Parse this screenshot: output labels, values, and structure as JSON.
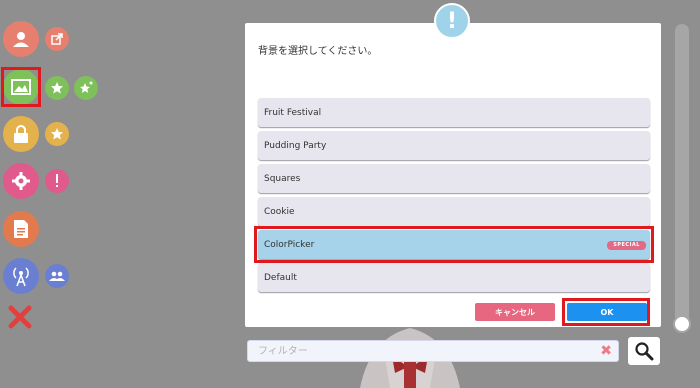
{
  "sidebar": {
    "buttons": [
      {
        "icon": "user-icon"
      },
      {
        "icon": "share-icon"
      },
      {
        "icon": "background-image-icon"
      },
      {
        "icon": "star-icon"
      },
      {
        "icon": "star-sparkle-icon"
      },
      {
        "icon": "lock-icon"
      },
      {
        "icon": "star-icon"
      },
      {
        "icon": "gear-icon"
      },
      {
        "icon": "exclamation-icon"
      },
      {
        "icon": "document-icon"
      },
      {
        "icon": "broadcast-tower-icon"
      },
      {
        "icon": "group-icon"
      },
      {
        "icon": "close-icon"
      }
    ]
  },
  "dialog": {
    "badge": "!",
    "message": "背景を選択してください。",
    "options": [
      {
        "label": "Fruit Festival",
        "tag": ""
      },
      {
        "label": "Pudding Party",
        "tag": ""
      },
      {
        "label": "Squares",
        "tag": ""
      },
      {
        "label": "Cookie",
        "tag": ""
      },
      {
        "label": "ColorPicker",
        "tag": "SPECIAL"
      },
      {
        "label": "Default",
        "tag": ""
      }
    ],
    "cancel_label": "キャンセル",
    "ok_label": "OK"
  },
  "filter": {
    "placeholder": "フィルター",
    "value": ""
  },
  "colors": {
    "overlay": "#8f8f8f",
    "selected": "#a6d3ea",
    "highlight": "#e0191f",
    "cancel": "#e6677f",
    "ok": "#1c91ef",
    "special": "#e36a86"
  }
}
